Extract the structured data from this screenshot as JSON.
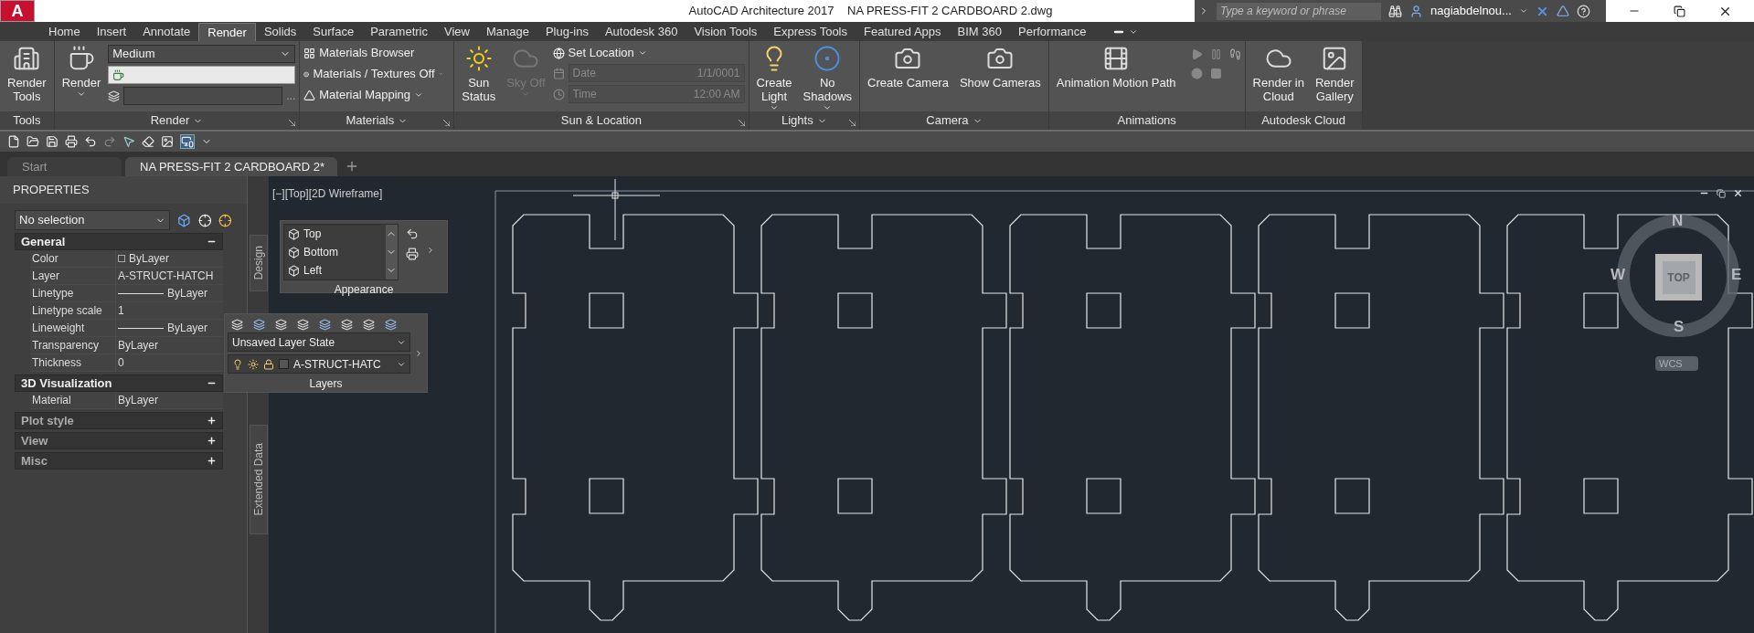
{
  "title_bar": {
    "logo": "A",
    "title": "AutoCAD Architecture 2017    NA PRESS-FIT 2 CARDBOARD 2.dwg",
    "search_placeholder": "Type a keyword or phrase",
    "user": "nagiabdelnou..."
  },
  "ribbon_tabs": [
    {
      "label": "Home",
      "selected": false
    },
    {
      "label": "Insert",
      "selected": false
    },
    {
      "label": "Annotate",
      "selected": false
    },
    {
      "label": "Render",
      "selected": true
    },
    {
      "label": "Solids",
      "selected": false
    },
    {
      "label": "Surface",
      "selected": false
    },
    {
      "label": "Parametric",
      "selected": false
    },
    {
      "label": "View",
      "selected": false
    },
    {
      "label": "Manage",
      "selected": false
    },
    {
      "label": "Plug-ins",
      "selected": false
    },
    {
      "label": "Autodesk 360",
      "selected": false
    },
    {
      "label": "Vision Tools",
      "selected": false
    },
    {
      "label": "Express Tools",
      "selected": false
    },
    {
      "label": "Featured Apps",
      "selected": false
    },
    {
      "label": "BIM 360",
      "selected": false
    },
    {
      "label": "Performance",
      "selected": false
    }
  ],
  "ribbon_panels": [
    {
      "kind": "tools",
      "title": "Tools",
      "title_menu": false,
      "launcher": false,
      "buttons": [
        {
          "lines": [
            "Render",
            "Tools"
          ],
          "dropdown": false,
          "disabled": false
        }
      ]
    },
    {
      "kind": "render",
      "title": "Render",
      "title_menu": true,
      "launcher": true,
      "buttons": [
        {
          "lines": [
            "Render"
          ],
          "dropdown": true,
          "disabled": false
        }
      ],
      "preset": "Medium",
      "ellipsis": "..."
    },
    {
      "kind": "materials",
      "title": "Materials",
      "title_menu": true,
      "launcher": true,
      "items": [
        {
          "label": "Materials Browser",
          "dropdown": false
        },
        {
          "label": "Materials / Textures Off",
          "dropdown": true
        },
        {
          "label": "Material Mapping",
          "dropdown": true
        }
      ]
    },
    {
      "kind": "sun",
      "title": "Sun & Location",
      "title_menu": false,
      "launcher": true,
      "buttons": [
        {
          "lines": [
            "Sun",
            "Status"
          ],
          "dropdown": false,
          "disabled": false
        },
        {
          "lines": [
            "Sky Off"
          ],
          "dropdown": true,
          "disabled": true
        }
      ],
      "set_location": "Set Location",
      "fields": [
        {
          "label": "Date",
          "value": "1/1/0001",
          "disabled": true
        },
        {
          "label": "Time",
          "value": "12:00 AM",
          "disabled": true
        }
      ]
    },
    {
      "kind": "lights",
      "title": "Lights",
      "title_menu": true,
      "launcher": true,
      "buttons": [
        {
          "lines": [
            "Create",
            "Light"
          ],
          "dropdown": true,
          "disabled": false
        },
        {
          "lines": [
            "No",
            "Shadows"
          ],
          "dropdown": true,
          "disabled": false
        }
      ]
    },
    {
      "kind": "camera",
      "title": "Camera",
      "title_menu": true,
      "launcher": false,
      "buttons": [
        {
          "lines": [
            "Create Camera"
          ],
          "dropdown": false,
          "disabled": false
        },
        {
          "lines": [
            "Show Cameras"
          ],
          "dropdown": false,
          "disabled": false
        }
      ]
    },
    {
      "kind": "animations",
      "title": "Animations",
      "title_menu": false,
      "launcher": false,
      "buttons": [
        {
          "lines": [
            "Animation Motion Path"
          ],
          "dropdown": false,
          "disabled": false
        }
      ]
    },
    {
      "kind": "cloud",
      "title": "Autodesk Cloud",
      "title_menu": false,
      "launcher": false,
      "buttons": [
        {
          "lines": [
            "Render in",
            "Cloud"
          ],
          "dropdown": false,
          "disabled": false
        },
        {
          "lines": [
            "Render",
            "Gallery"
          ],
          "dropdown": false,
          "disabled": false
        }
      ]
    }
  ],
  "document_tabs": [
    {
      "label": "Start",
      "selected": false
    },
    {
      "label": "NA PRESS-FIT 2 CARDBOARD 2*",
      "selected": true
    }
  ],
  "properties": {
    "title": "PROPERTIES",
    "selection": "No selection",
    "side_tabs": [
      "Design",
      "Extended Data"
    ],
    "sections": [
      {
        "title": "General",
        "expanded": true,
        "rows": [
          {
            "label": "Color",
            "value": "ByLayer",
            "kind": "swatch"
          },
          {
            "label": "Layer",
            "value": "A-STRUCT-HATCH",
            "kind": "text"
          },
          {
            "label": "Linetype",
            "value": "ByLayer",
            "kind": "line"
          },
          {
            "label": "Linetype scale",
            "value": "1",
            "kind": "text"
          },
          {
            "label": "Lineweight",
            "value": "ByLayer",
            "kind": "line"
          },
          {
            "label": "Transparency",
            "value": "ByLayer",
            "kind": "text"
          },
          {
            "label": "Thickness",
            "value": "0",
            "kind": "text"
          }
        ]
      },
      {
        "title": "3D Visualization",
        "expanded": true,
        "rows": [
          {
            "label": "Material",
            "value": "ByLayer",
            "kind": "text"
          }
        ]
      },
      {
        "title": "Plot style",
        "expanded": false
      },
      {
        "title": "View",
        "expanded": false
      },
      {
        "title": "Misc",
        "expanded": false
      }
    ]
  },
  "viewport": {
    "label": "[−][Top][2D Wireframe]",
    "viewcube": {
      "north": "N",
      "south": "S",
      "east": "E",
      "west": "W",
      "face": "TOP",
      "ucs": "WCS"
    }
  },
  "appearance_toolbar": {
    "title": "Appearance",
    "views": [
      "Top",
      "Bottom",
      "Left"
    ]
  },
  "layers_toolbar": {
    "title": "Layers",
    "layer_state": "Unsaved Layer State",
    "current_layer": "A-STRUCT-HATC"
  }
}
